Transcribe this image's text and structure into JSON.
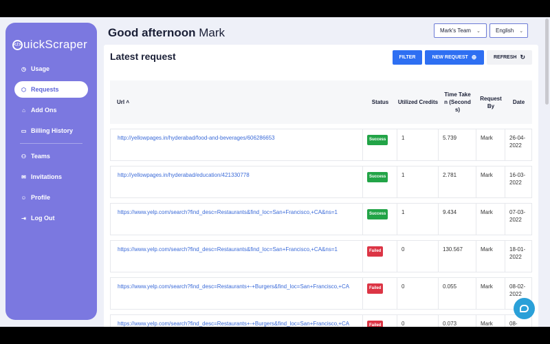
{
  "brand": {
    "logo_letter": "</>",
    "name": "uickScraper"
  },
  "nav": [
    {
      "key": "usage",
      "label": "Usage",
      "icon": "◷"
    },
    {
      "key": "requests",
      "label": "Requests",
      "icon": "⬡"
    },
    {
      "key": "add-ons",
      "label": "Add Ons",
      "icon": "⌂"
    },
    {
      "key": "billing-history",
      "label": "Billing History",
      "icon": "▭"
    },
    {
      "key": "teams",
      "label": "Teams",
      "icon": "⚇"
    },
    {
      "key": "invitations",
      "label": "Invitations",
      "icon": "✉"
    },
    {
      "key": "profile",
      "label": "Profile",
      "icon": "☺"
    },
    {
      "key": "log-out",
      "label": "Log Out",
      "icon": "⇥"
    }
  ],
  "header": {
    "greeting": "Good afternoon",
    "user": "Mark",
    "team_select": "Mark's Team",
    "language_select": "English"
  },
  "card": {
    "title": "Latest request",
    "filter_label": "FILTER",
    "new_request_label": "NEW REQUEST",
    "refresh_label": "REFRESH"
  },
  "table": {
    "headers": {
      "url": "Url ˄",
      "status": "Status",
      "credits": "Utilized Credits",
      "time": "Time Taken (Seconds)",
      "by": "Request By",
      "date": "Date"
    },
    "rows": [
      {
        "url": "http://yellowpages.in/hyderabad/food-and-beverages/606286653",
        "status": "Success",
        "credits": "1",
        "time": "5.739",
        "by": "Mark",
        "date": "26-04-2022"
      },
      {
        "url": "http://yellowpages.in/hyderabad/education/421330778",
        "status": "Success",
        "credits": "1",
        "time": "2.781",
        "by": "Mark",
        "date": "16-03-2022"
      },
      {
        "url": "https://www.yelp.com/search?find_desc=Restaurants&find_loc=San+Francisco,+CA&ns=1",
        "status": "Success",
        "credits": "1",
        "time": "9.434",
        "by": "Mark",
        "date": "07-03-2022"
      },
      {
        "url": "https://www.yelp.com/search?find_desc=Restaurants&find_loc=San+Francisco,+CA&ns=1",
        "status": "Failed",
        "credits": "0",
        "time": "130.567",
        "by": "Mark",
        "date": "18-01-2022"
      },
      {
        "url": "https://www.yelp.com/search?find_desc=Restaurants+-+Burgers&find_loc=San+Francisco,+CA",
        "status": "Failed",
        "credits": "0",
        "time": "0.055",
        "by": "Mark",
        "date": "08-02-2022"
      },
      {
        "url": "https://www.yelp.com/search?find_desc=Restaurants+-+Burgers&find_loc=San+Francisco,+CA",
        "status": "Failed",
        "credits": "0",
        "time": "0.073",
        "by": "Mark",
        "date": "08-"
      }
    ]
  },
  "colors": {
    "sidebar": "#7b78e0",
    "primary": "#2e6ff2",
    "success": "#22a447",
    "failed": "#dc3545"
  }
}
